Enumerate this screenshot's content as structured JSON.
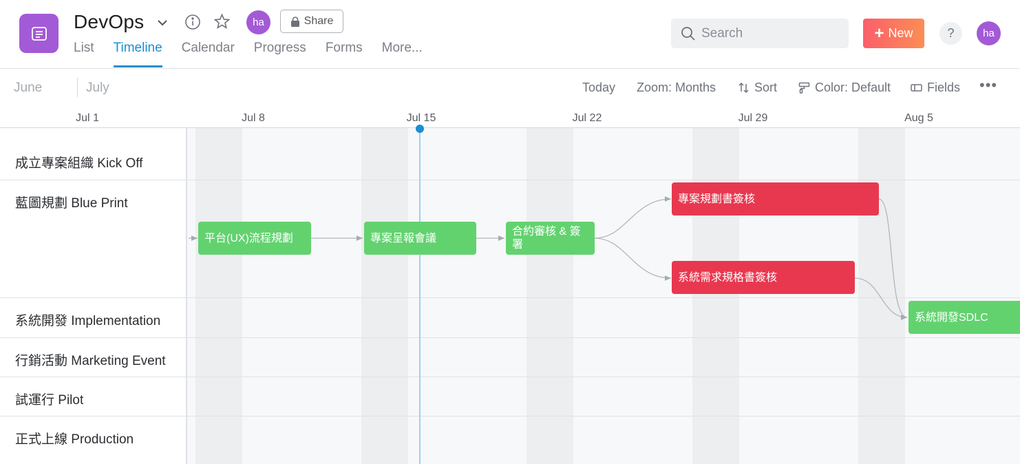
{
  "header": {
    "title": "DevOps",
    "user_initials": "ha",
    "share_label": "Share",
    "tabs": [
      "List",
      "Timeline",
      "Calendar",
      "Progress",
      "Forms",
      "More..."
    ],
    "active_tab": "Timeline",
    "search_placeholder": "Search",
    "new_label": "New",
    "help_label": "?",
    "brand_colors": {
      "accent": "#1a8fd1",
      "avatar": "#a35ad6",
      "new_start": "#fb5f6b",
      "new_end": "#fc8d54"
    }
  },
  "toolbar": {
    "months": [
      "June",
      "July"
    ],
    "today": "Today",
    "zoom": "Zoom: Months",
    "sort": "Sort",
    "color": "Color: Default",
    "fields": "Fields",
    "more": "•••"
  },
  "timeline": {
    "dates": [
      "Jul 1",
      "Jul 8",
      "Jul 15",
      "Jul 22",
      "Jul 29",
      "Aug 5"
    ],
    "groups": [
      "成立專案組織 Kick Off",
      "藍圖規劃 Blue Print",
      "系統開發 Implementation",
      "行銷活動 Marketing Event",
      "試運行 Pilot",
      "正式上線 Production"
    ],
    "tasks": [
      {
        "name": "平台(UX)流程規劃",
        "color": "#62d26f",
        "status": "green"
      },
      {
        "name": "專案呈報會議",
        "color": "#62d26f",
        "status": "green"
      },
      {
        "name": "合約審核 & 簽署",
        "color": "#62d26f",
        "status": "green"
      },
      {
        "name": "專案規劃書簽核",
        "color": "#e8384f",
        "status": "red"
      },
      {
        "name": "系統需求規格書簽核",
        "color": "#e8384f",
        "status": "red"
      },
      {
        "name": "系統開發SDLC",
        "color": "#62d26f",
        "status": "green"
      }
    ]
  }
}
